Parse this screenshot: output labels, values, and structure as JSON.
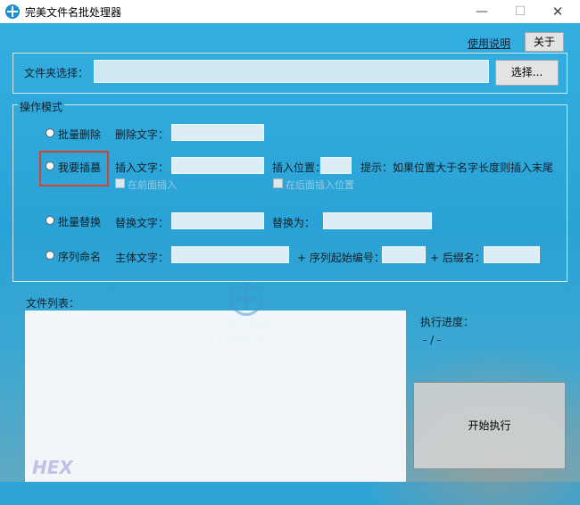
{
  "window": {
    "title": "完美文件名批处理器",
    "minimize": "—",
    "maximize": "☐",
    "close": "✕"
  },
  "header": {
    "help_link": "使用说明",
    "about_button": "关于"
  },
  "folder": {
    "label": "文件夹选择：",
    "value": "",
    "choose_button": "选择..."
  },
  "mode": {
    "legend": "操作模式",
    "batch_delete": {
      "radio": "批量删除",
      "field_label": "删除文字：",
      "value": ""
    },
    "insert": {
      "radio": "我要插墓",
      "text_label": "插入文字：",
      "text_value": "",
      "pos_label": "插入位置：",
      "pos_value": "",
      "hint": "提示：如果位置大于名字长度则插入末尾",
      "check1_label": "在前面插入",
      "check2_label": "在后面插入位置"
    },
    "replace": {
      "radio": "批量替换",
      "from_label": "替换文字：",
      "to_label": "替换为：",
      "from_value": "",
      "to_value": ""
    },
    "sequence": {
      "radio": "序列命名",
      "main_label": "主体文字：",
      "start_label": "+ 序列起始编号：",
      "suffix_label": "+ 后缀名：",
      "main_value": "",
      "start_value": "",
      "suffix_value": ""
    }
  },
  "files": {
    "label": "文件列表：",
    "items": []
  },
  "progress": {
    "label": "执行进度：",
    "value": "- / -"
  },
  "run": {
    "start_button": "开始执行"
  },
  "watermark": {
    "line1": "完美文件名批",
    "line2": "处理器(Ver..."
  },
  "corner_logo": "HEX",
  "colors": {
    "background": "#2fa4d6",
    "highlight": "#d4432d"
  }
}
